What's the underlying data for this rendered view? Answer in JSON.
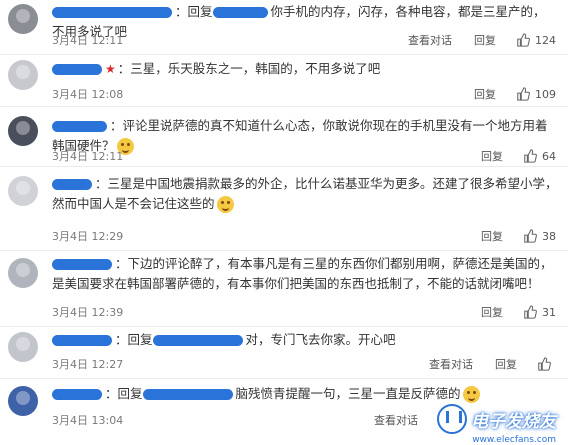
{
  "comments": [
    {
      "prefix": "：回复",
      "text": "你手机的内存，闪存，各种电容，都是三星产的，不用多说了吧",
      "date": "3月4日 12:11",
      "actions": [
        "查看对话",
        "回复"
      ],
      "likes": "124"
    },
    {
      "prefix": "：",
      "text": "三星，乐天股东之一，韩国的，不用多说了吧",
      "date": "3月4日 12:08",
      "actions": [
        "回复"
      ],
      "likes": "109"
    },
    {
      "prefix": "：",
      "text": "评论里说萨德的真不知道什么心态，你敢说你现在的手机里没有一个地方用着韩国硬件？",
      "date": "3月4日 12:11",
      "actions": [
        "回复"
      ],
      "likes": "64"
    },
    {
      "prefix": "：",
      "text": "三星是中国地震捐款最多的外企，比什么诺基亚华为更多。还建了很多希望小学，然而中国人是不会记住这些的",
      "date": "3月4日 12:29",
      "actions": [
        "回复"
      ],
      "likes": "38"
    },
    {
      "prefix": "：",
      "text": "下边的评论醉了，有本事凡是有三星的东西你们都别用啊，萨德还是美国的，是美国要求在韩国部署萨德的，有本事你们把美国的东西也抵制了，不能的话就闭嘴吧！",
      "date": "3月4日 12:39",
      "actions": [
        "回复"
      ],
      "likes": "31"
    },
    {
      "prefix": "：回复",
      "text": "对，专门飞去你家。开心吧",
      "date": "3月4日 12:27",
      "actions": [
        "查看对话",
        "回复"
      ],
      "likes": ""
    },
    {
      "prefix": "：回复",
      "text": "脑残愤青提醒一句，三星一直是反萨德的",
      "date": "3月4日 13:04",
      "actions": [
        "查看对话",
        "回复"
      ],
      "likes": ""
    }
  ],
  "watermark": {
    "text": "电子发烧友",
    "url": "www.elecfans.com"
  },
  "colors": {
    "link": "#2a73d8",
    "meta": "#7a7a7a",
    "divider": "#ececec"
  }
}
